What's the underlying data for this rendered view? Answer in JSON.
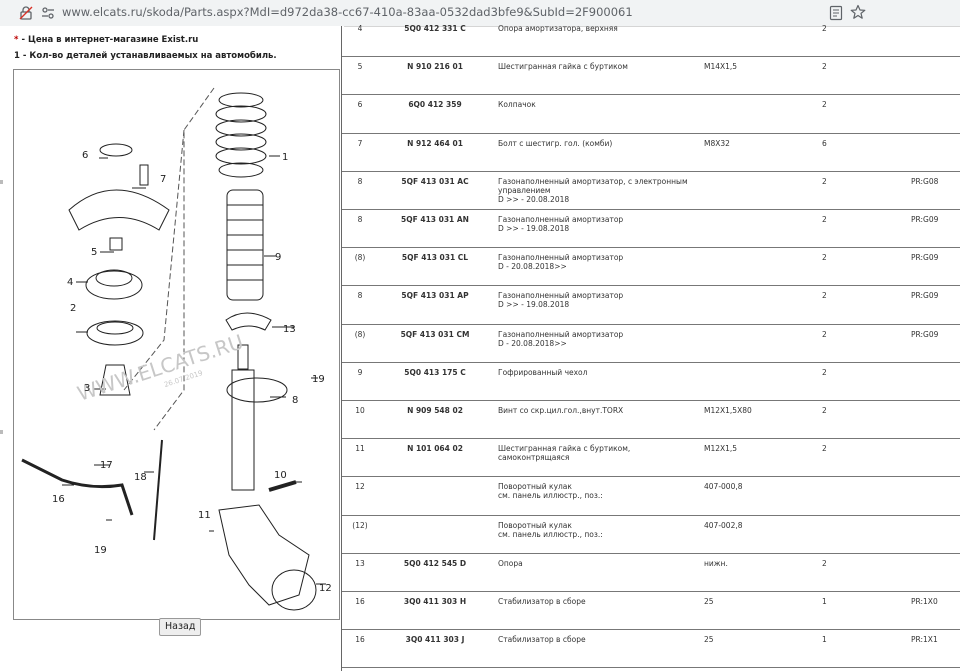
{
  "browser": {
    "url": "www.elcats.ru/skoda/Parts.aspx?MdI=d972da38-cc67-410a-83aa-0532dad3bfe9&SubId=2F900061"
  },
  "legend": {
    "line1_mark": "*",
    "line1_text": "- Цена в интернет-магазине Exist.ru",
    "line2_mark": "1",
    "line2_text": "- Кол-во деталей устанавливаемых на автомобиль."
  },
  "diagram": {
    "watermark": "WWW.ELCATS.RU",
    "date": "26.07.2019",
    "callouts": [
      "1",
      "2",
      "3",
      "4",
      "5",
      "6",
      "7",
      "8",
      "9",
      "10",
      "11",
      "12",
      "13",
      "16",
      "17",
      "18",
      "19",
      "19"
    ]
  },
  "back_button": "Назад",
  "parts": [
    {
      "num": "4",
      "code": "5Q0 412 331 C",
      "name": "Опора амортизатора, верхняя",
      "note": "",
      "qty": "2",
      "info": ""
    },
    {
      "num": "5",
      "code": "N 910 216 01",
      "name": "Шестигранная гайка с буртиком",
      "note": "M14X1,5",
      "qty": "2",
      "info": ""
    },
    {
      "num": "6",
      "code": "6Q0 412 359",
      "name": "Колпачок",
      "note": "",
      "qty": "2",
      "info": ""
    },
    {
      "num": "7",
      "code": "N 912 464 01",
      "name": "Болт с шестигр. гол. (комби)",
      "note": "M8X32",
      "qty": "6",
      "info": ""
    },
    {
      "num": "8",
      "code": "5QF 413 031 AC",
      "name": "Газонаполненный амортизатор, с электронным управлением",
      "name2": "D >> - 20.08.2018",
      "note": "",
      "qty": "2",
      "info": "PR:G08"
    },
    {
      "num": "8",
      "code": "5QF 413 031 AN",
      "name": "Газонаполненный амортизатор",
      "name2": "D >> - 19.08.2018",
      "note": "",
      "qty": "2",
      "info": "PR:G09"
    },
    {
      "num": "(8)",
      "code": "5QF 413 031 CL",
      "name": "Газонаполненный амортизатор",
      "name2": "D - 20.08.2018>>",
      "note": "",
      "qty": "2",
      "info": "PR:G09"
    },
    {
      "num": "8",
      "code": "5QF 413 031 AP",
      "name": "Газонаполненный амортизатор",
      "name2": "D >> - 19.08.2018",
      "note": "",
      "qty": "2",
      "info": "PR:G09"
    },
    {
      "num": "(8)",
      "code": "5QF 413 031 CM",
      "name": "Газонаполненный амортизатор",
      "name2": "D - 20.08.2018>>",
      "note": "",
      "qty": "2",
      "info": "PR:G09"
    },
    {
      "num": "9",
      "code": "5Q0 413 175 C",
      "name": "Гофрированный чехол",
      "note": "",
      "qty": "2",
      "info": ""
    },
    {
      "num": "10",
      "code": "N 909 548 02",
      "name": "Винт со скр.цил.гол.,внут.TORX",
      "note": "M12X1,5X80",
      "qty": "2",
      "info": ""
    },
    {
      "num": "11",
      "code": "N 101 064 02",
      "name": "Шестигранная гайка с буртиком, самоконтрящаяся",
      "note": "M12X1,5",
      "qty": "2",
      "info": ""
    },
    {
      "num": "12",
      "code": "",
      "name": "Поворотный кулак",
      "name2": "см. панель иллюстр., поз.:",
      "note": "407-000,8",
      "qty": "",
      "info": ""
    },
    {
      "num": "(12)",
      "code": "",
      "name": "Поворотный кулак",
      "name2": "см. панель иллюстр., поз.:",
      "note": "407-002,8",
      "qty": "",
      "info": ""
    },
    {
      "num": "13",
      "code": "5Q0 412 545 D",
      "name": "Опора",
      "note": "нижн.",
      "qty": "2",
      "info": ""
    },
    {
      "num": "16",
      "code": "3Q0 411 303 H",
      "name": "Стабилизатор в сборе",
      "note": "25",
      "qty": "1",
      "info": "PR:1X0"
    },
    {
      "num": "16",
      "code": "3Q0 411 303 J",
      "name": "Стабилизатор в сборе",
      "note": "25",
      "qty": "1",
      "info": "PR:1X1"
    }
  ]
}
